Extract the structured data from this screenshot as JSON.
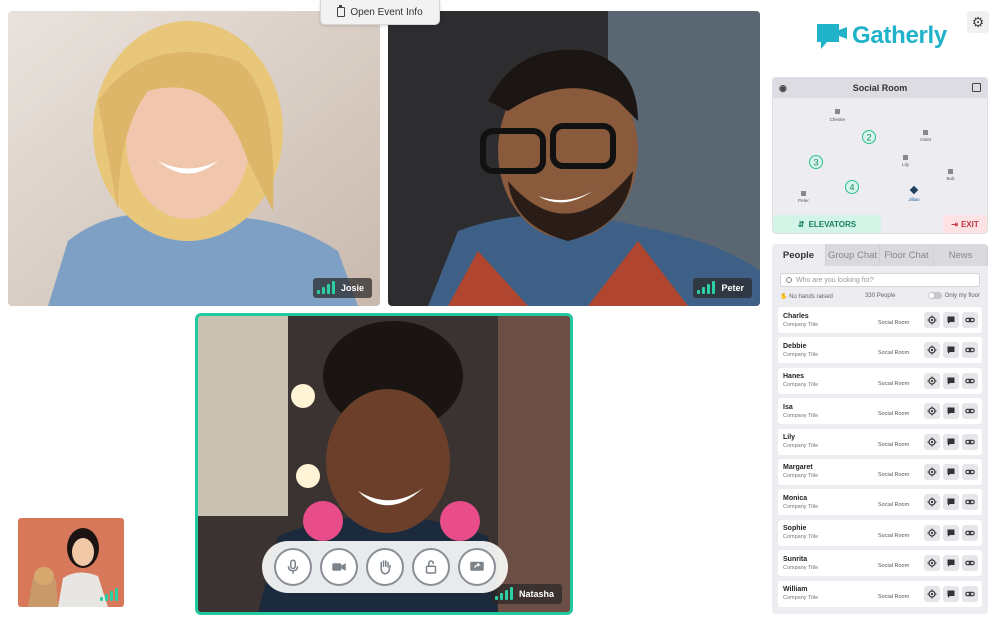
{
  "header": {
    "event_info_label": "Open Event Info"
  },
  "brand": {
    "name": "Gatherly",
    "color": "#1fb2c9"
  },
  "videos": [
    {
      "name": "Josie"
    },
    {
      "name": "Peter"
    },
    {
      "name": "Natasha"
    }
  ],
  "controls": [
    {
      "icon": "microphone-icon"
    },
    {
      "icon": "camera-icon"
    },
    {
      "icon": "raise-hand-icon"
    },
    {
      "icon": "lock-icon"
    },
    {
      "icon": "share-screen-icon"
    }
  ],
  "room": {
    "title": "Social Room",
    "people": [
      "Chester",
      "Violet",
      "Lily",
      "Bob",
      "Peter",
      "Jillian"
    ],
    "groups": [
      "2",
      "3",
      "4"
    ],
    "elevators_label": "ELEVATORS",
    "exit_label": "EXIT"
  },
  "panel": {
    "tabs": [
      "People",
      "Group Chat",
      "Floor Chat",
      "News"
    ],
    "search_placeholder": "Who are you looking for?",
    "no_hands": "No hands raised",
    "people_count": "330 People",
    "only_my_floor": "Only my floor",
    "people": [
      {
        "name": "Charles",
        "title": "Company Title",
        "location": "Social Room"
      },
      {
        "name": "Debbie",
        "title": "Company Title",
        "location": "Social Room"
      },
      {
        "name": "Hanes",
        "title": "Company Title",
        "location": "Social Room"
      },
      {
        "name": "Isa",
        "title": "Company Title",
        "location": "Social Room"
      },
      {
        "name": "Lily",
        "title": "Company Title",
        "location": "Social Room"
      },
      {
        "name": "Margaret",
        "title": "Company Title",
        "location": "Social Room"
      },
      {
        "name": "Monica",
        "title": "Company Title",
        "location": "Social Room"
      },
      {
        "name": "Sophie",
        "title": "Company Title",
        "location": "Social Room"
      },
      {
        "name": "Sunrita",
        "title": "Company Title",
        "location": "Social Room"
      },
      {
        "name": "William",
        "title": "Company Title",
        "location": "Social Room"
      }
    ]
  },
  "colors": {
    "accent": "#22c9a0",
    "signal": "#2bd1a4",
    "exit": "#c23a45",
    "elevators": "#1b7d60"
  }
}
